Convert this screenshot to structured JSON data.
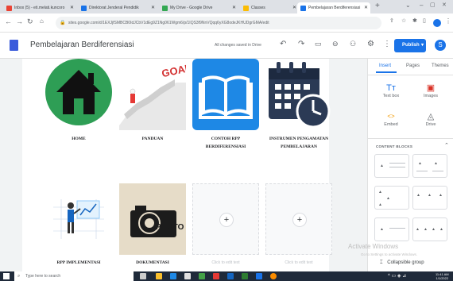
{
  "browser": {
    "tabs": [
      {
        "label": "Inbox (5) - eti.melati.kuncoro",
        "color": "#ea4335"
      },
      {
        "label": "Direktorat Jenderal Pendidik",
        "color": "#1a73e8"
      },
      {
        "label": "My Drive - Google Drive",
        "color": "#34a853"
      },
      {
        "label": "Classes",
        "color": "#fbbc04"
      },
      {
        "label": "Pembelajaran Berdiferensiasi",
        "color": "#1a73e8"
      }
    ],
    "new_tab": "+",
    "url": "sites.google.com/d/1EXJjfSMBCB0IdJCbV1dEg9Z1Ng061Wgm6/p/1IQS3f9NnVQqq6yXG8odeJKHUDgrGMA/edit"
  },
  "site": {
    "title": "Pembelajaran Berdiferensiasi",
    "saved_status": "All changes saved in Drive",
    "publish_label": "Publish",
    "avatar_letter": "S"
  },
  "tiles": [
    {
      "caption": "HOME"
    },
    {
      "caption": "PANDUAN",
      "goal_text": "GOAL"
    },
    {
      "caption": "CONTOH RPP BERDIFERENSIASI"
    },
    {
      "caption": "INSTRUMEN PENGAMATAN PEMBELAJARAN"
    },
    {
      "caption": "RPP IMPLEMENTASI"
    },
    {
      "caption": "DOKUMENTASI",
      "photo_text": "PHOTO",
      "photo_sub": "GRAPHY"
    },
    {
      "caption": "Click to edit text",
      "plus": "+"
    },
    {
      "caption": "Click to edit text",
      "plus": "+"
    }
  ],
  "panel": {
    "tabs": [
      "Insert",
      "Pages",
      "Themes"
    ],
    "items": [
      {
        "icon": "Tт",
        "label": "Text box"
      },
      {
        "icon": "▣",
        "label": "Images"
      },
      {
        "icon": "<>",
        "label": "Embed"
      },
      {
        "icon": "◬",
        "label": "Drive"
      }
    ],
    "blocks_label": "CONTENT BLOCKS",
    "collapsible": "Collapsible group"
  },
  "watermark": {
    "title": "Activate Windows",
    "sub": "Go to Settings to activate Windows."
  },
  "taskbar": {
    "search_placeholder": "Type here to search",
    "time": "11:41 AM",
    "date": "1/1/2022"
  }
}
